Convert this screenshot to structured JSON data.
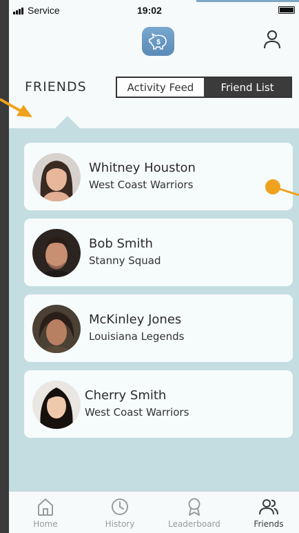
{
  "status": {
    "carrier": "Service",
    "time": "19:02"
  },
  "header": {
    "logo_icon": "piggy-bank-dollar-icon",
    "profile_icon": "user-icon"
  },
  "title": "FRIENDS",
  "segmented": {
    "options": [
      {
        "label": "Activity Feed",
        "selected": false
      },
      {
        "label": "Friend List",
        "selected": true
      }
    ]
  },
  "friends": [
    {
      "name": "Whitney Houston",
      "team": "West Coast Warriors"
    },
    {
      "name": "Bob Smith",
      "team": "Stanny Squad"
    },
    {
      "name": "McKinley Jones",
      "team": "Louisiana Legends"
    },
    {
      "name": "Cherry Smith",
      "team": "West Coast Warriors"
    }
  ],
  "tabs": [
    {
      "label": "Home",
      "icon": "home-icon",
      "active": false
    },
    {
      "label": "History",
      "icon": "clock-icon",
      "active": false
    },
    {
      "label": "Leaderboard",
      "icon": "award-icon",
      "active": false
    },
    {
      "label": "Friends",
      "icon": "users-icon",
      "active": true
    }
  ],
  "colors": {
    "accent": "#f0a11e",
    "panel": "#c4dde0",
    "dark": "#3b3b3b",
    "logo": "#6a98c2"
  }
}
